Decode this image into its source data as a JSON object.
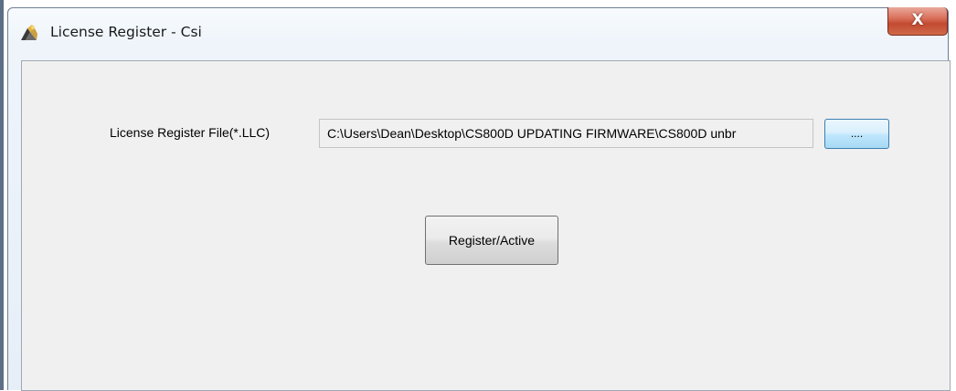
{
  "window": {
    "title": "License Register - Csi",
    "close_label": "X"
  },
  "form": {
    "file_label": "License Register File(*.LLC)",
    "file_path": "C:\\Users\\Dean\\Desktop\\CS800D UPDATING FIRMWARE\\CS800D unbr",
    "browse_label": "....",
    "register_label": "Register/Active"
  },
  "icons": {
    "app": "app-icon",
    "close": "close-icon"
  },
  "colors": {
    "close_button": "#c9513a",
    "browse_button": "#bee6fd",
    "client_bg": "#f0f0f0"
  }
}
